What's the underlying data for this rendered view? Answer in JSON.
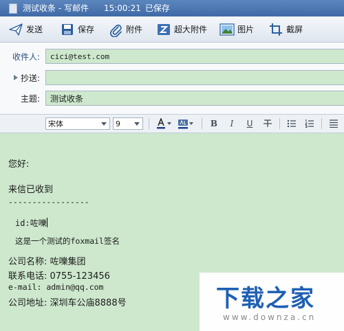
{
  "window": {
    "title": "测试收条 - 写邮件",
    "time": "15:00:21",
    "save_status": "已保存"
  },
  "toolbar": {
    "send": "发送",
    "save": "保存",
    "attach": "附件",
    "big_attach": "超大附件",
    "picture": "图片",
    "screenshot": "截屏",
    "icons": [
      "send-icon",
      "save-icon",
      "paperclip-icon",
      "big-attachment-icon",
      "picture-icon",
      "screenshot-icon"
    ]
  },
  "headers": {
    "to_label": "收件人:",
    "to_value": "cici@test.com",
    "cc_label": "抄送:",
    "cc_value": "",
    "subject_label": "主题:",
    "subject_value": "测试收条"
  },
  "format": {
    "font": "宋体",
    "size": "9",
    "icons": [
      "text-color-icon",
      "highlight-icon",
      "bold-icon",
      "italic-icon",
      "underline-icon",
      "strikethrough-icon",
      "bullet-list-icon",
      "numbered-list-icon",
      "align-icon"
    ]
  },
  "body": {
    "greeting": "您好:",
    "line1": "来信已收到",
    "divider": "-----------------",
    "sig_id": "id:咗嚛",
    "sig_text": "这是一个测试的foxmail签名",
    "company": "公司名称: 咗嚛集团",
    "phone": "联系电话: 0755-123456",
    "email": "e-mail: admin@qq.com",
    "address": "公司地址: 深圳车公庙8888号"
  },
  "watermark": {
    "main": "下载之家",
    "sub": "www.downza.cn"
  },
  "colors": {
    "titlebar": "#4a76b0",
    "body_background": "#cde8cd",
    "watermark_blue": "#1f5fb4"
  }
}
